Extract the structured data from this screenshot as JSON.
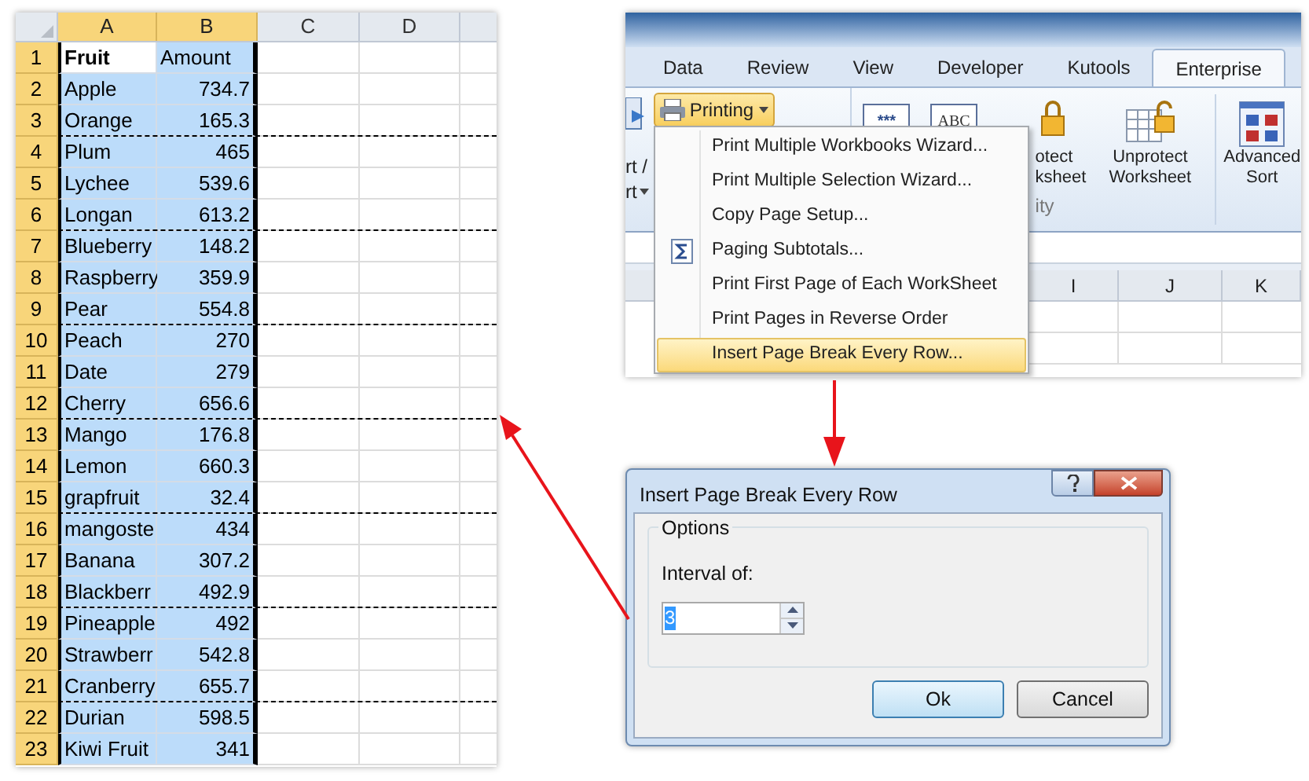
{
  "spreadsheet": {
    "columns": [
      {
        "label": "A",
        "selected": true
      },
      {
        "label": "B",
        "selected": true
      },
      {
        "label": "C",
        "selected": false
      },
      {
        "label": "D",
        "selected": false
      }
    ],
    "rows": [
      {
        "number": "1",
        "cells": [
          "Fruit",
          "Amount"
        ],
        "kind": "header",
        "active": true,
        "selected": true,
        "page_break_below": false
      },
      {
        "number": "2",
        "cells": [
          "Apple",
          "734.7"
        ],
        "kind": "data",
        "active": false,
        "selected": true,
        "page_break_below": false
      },
      {
        "number": "3",
        "cells": [
          "Orange",
          "165.3"
        ],
        "kind": "data",
        "active": false,
        "selected": true,
        "page_break_below": true
      },
      {
        "number": "4",
        "cells": [
          "Plum",
          "465"
        ],
        "kind": "data",
        "active": false,
        "selected": true,
        "page_break_below": false
      },
      {
        "number": "5",
        "cells": [
          "Lychee",
          "539.6"
        ],
        "kind": "data",
        "active": false,
        "selected": true,
        "page_break_below": false
      },
      {
        "number": "6",
        "cells": [
          "Longan",
          "613.2"
        ],
        "kind": "data",
        "active": false,
        "selected": true,
        "page_break_below": true
      },
      {
        "number": "7",
        "cells": [
          "Blueberry",
          "148.2"
        ],
        "kind": "data",
        "active": false,
        "selected": true,
        "page_break_below": false
      },
      {
        "number": "8",
        "cells": [
          "Raspberry",
          "359.9"
        ],
        "kind": "data",
        "active": false,
        "selected": true,
        "page_break_below": false
      },
      {
        "number": "9",
        "cells": [
          "Pear",
          "554.8"
        ],
        "kind": "data",
        "active": false,
        "selected": true,
        "page_break_below": true
      },
      {
        "number": "10",
        "cells": [
          "Peach",
          "270"
        ],
        "kind": "data",
        "active": false,
        "selected": true,
        "page_break_below": false
      },
      {
        "number": "11",
        "cells": [
          "Date",
          "279"
        ],
        "kind": "data",
        "active": false,
        "selected": true,
        "page_break_below": false
      },
      {
        "number": "12",
        "cells": [
          "Cherry",
          "656.6"
        ],
        "kind": "data",
        "active": false,
        "selected": true,
        "page_break_below": true
      },
      {
        "number": "13",
        "cells": [
          "Mango",
          "176.8"
        ],
        "kind": "data",
        "active": false,
        "selected": true,
        "page_break_below": false
      },
      {
        "number": "14",
        "cells": [
          "Lemon",
          "660.3"
        ],
        "kind": "data",
        "active": false,
        "selected": true,
        "page_break_below": false
      },
      {
        "number": "15",
        "cells": [
          "grapfruit",
          "32.4"
        ],
        "kind": "data",
        "active": false,
        "selected": true,
        "page_break_below": true
      },
      {
        "number": "16",
        "cells": [
          "mangoste",
          "434"
        ],
        "kind": "data",
        "active": false,
        "selected": true,
        "page_break_below": false
      },
      {
        "number": "17",
        "cells": [
          "Banana",
          "307.2"
        ],
        "kind": "data",
        "active": false,
        "selected": true,
        "page_break_below": false
      },
      {
        "number": "18",
        "cells": [
          "Blackberr",
          "492.9"
        ],
        "kind": "data",
        "active": false,
        "selected": true,
        "page_break_below": true
      },
      {
        "number": "19",
        "cells": [
          "Pineapple",
          "492"
        ],
        "kind": "data",
        "active": false,
        "selected": true,
        "page_break_below": false
      },
      {
        "number": "20",
        "cells": [
          "Strawberr",
          "542.8"
        ],
        "kind": "data",
        "active": false,
        "selected": true,
        "page_break_below": false
      },
      {
        "number": "21",
        "cells": [
          "Cranberry",
          "655.7"
        ],
        "kind": "data",
        "active": false,
        "selected": true,
        "page_break_below": true
      },
      {
        "number": "22",
        "cells": [
          "Durian",
          "598.5"
        ],
        "kind": "data",
        "active": false,
        "selected": true,
        "page_break_below": false
      },
      {
        "number": "23",
        "cells": [
          "Kiwi Fruit",
          "341"
        ],
        "kind": "data",
        "active": false,
        "selected": true,
        "page_break_below": false
      }
    ]
  },
  "ribbon": {
    "tabs": [
      {
        "label": "Data",
        "selected": false
      },
      {
        "label": "Review",
        "selected": false
      },
      {
        "label": "View",
        "selected": false
      },
      {
        "label": "Developer",
        "selected": false
      },
      {
        "label": "Kutools",
        "selected": false
      },
      {
        "label": "Enterprise",
        "selected": true
      }
    ],
    "partial_labels": [
      "rt /",
      "rt"
    ],
    "printing_button": {
      "label": "Printing",
      "selected": true
    },
    "icon_texts": [
      "***",
      "ABC"
    ],
    "buttons": [
      {
        "lines": [
          "otect",
          "ksheet"
        ]
      },
      {
        "lines": [
          "Unprotect",
          "Worksheet"
        ]
      },
      {
        "lines": [
          "Advanced",
          "Sort"
        ]
      }
    ],
    "group_label": "ity",
    "menu": {
      "items": [
        {
          "label": "Print Multiple Workbooks Wizard...",
          "selected": false,
          "has_icon": false
        },
        {
          "label": "Print Multiple Selection Wizard...",
          "selected": false,
          "has_icon": false
        },
        {
          "label": "Copy Page Setup...",
          "selected": false,
          "has_icon": false
        },
        {
          "label": "Paging Subtotals...",
          "selected": false,
          "has_icon": true
        },
        {
          "label": "Print First Page of Each WorkSheet",
          "selected": false,
          "has_icon": false
        },
        {
          "label": "Print Pages in Reverse Order",
          "selected": false,
          "has_icon": false
        },
        {
          "label": "Insert Page Break Every Row...",
          "selected": true,
          "has_icon": false
        }
      ]
    },
    "sheet_columns": [
      "I",
      "J",
      "K"
    ]
  },
  "dialog": {
    "title": "Insert Page Break Every Row",
    "group_label": "Options",
    "field_label": "Interval of:",
    "value": "3",
    "buttons": [
      {
        "label": "Ok",
        "default": true
      },
      {
        "label": "Cancel",
        "default": false
      }
    ]
  }
}
